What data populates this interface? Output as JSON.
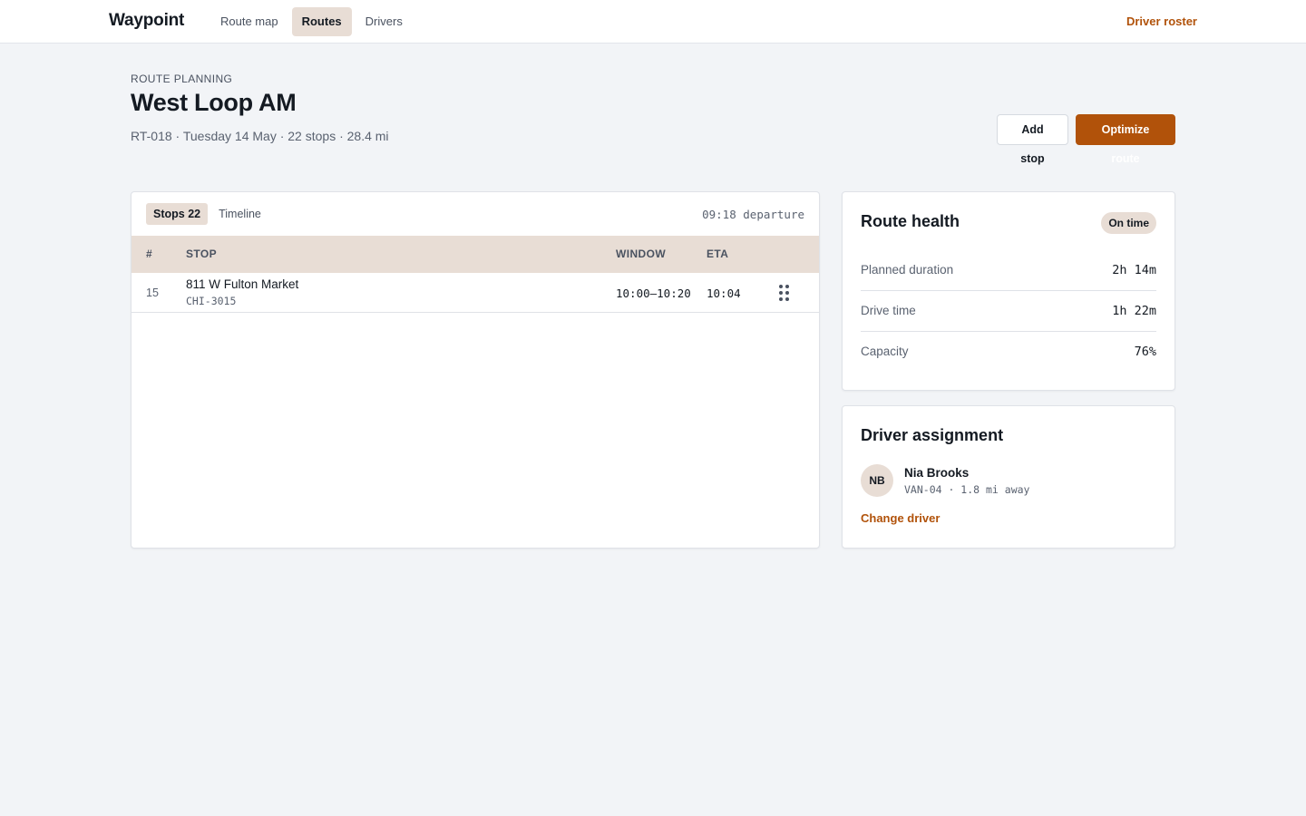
{
  "app": {
    "name": "Waypoint"
  },
  "nav": {
    "items": [
      {
        "label": "Route map",
        "active": false
      },
      {
        "label": "Routes",
        "active": true
      },
      {
        "label": "Drivers",
        "active": false
      }
    ],
    "roster_link": "Driver roster"
  },
  "header": {
    "eyebrow": "ROUTE PLANNING",
    "title": "West Loop AM",
    "meta": "RT-018 · Tuesday 14 May · 22 stops · 28.4 mi",
    "add_stop_label": "Add stop",
    "optimize_label": "Optimize route"
  },
  "stops": {
    "tabs": [
      {
        "label": "Stops 22",
        "active": true
      },
      {
        "label": "Timeline",
        "active": false
      }
    ],
    "departure": "09:18 departure",
    "columns": [
      "#",
      "STOP",
      "WINDOW",
      "ETA"
    ],
    "rows": [
      {
        "num": "15",
        "name": "811 W Fulton Market",
        "code": "CHI-3015",
        "window": "10:00–10:20",
        "eta": "10:04"
      }
    ]
  },
  "health": {
    "title": "Route health",
    "status": "On time",
    "metrics": [
      {
        "label": "Planned duration",
        "value": "2h 14m"
      },
      {
        "label": "Drive time",
        "value": "1h 22m"
      },
      {
        "label": "Capacity",
        "value": "76%"
      }
    ]
  },
  "driver": {
    "title": "Driver assignment",
    "initials": "NB",
    "name": "Nia Brooks",
    "meta": "VAN-04 · 1.8 mi away",
    "change_label": "Change driver"
  },
  "colors": {
    "accent": "#b1520a",
    "tint": "#e8ddd5",
    "background": "#f2f4f7"
  }
}
